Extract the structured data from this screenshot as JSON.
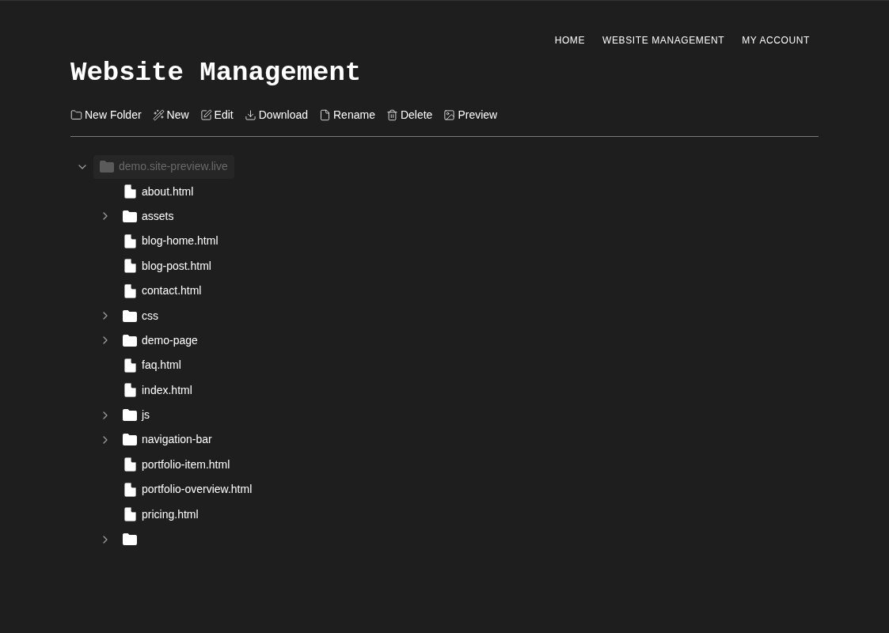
{
  "nav": [
    {
      "label": "HOME"
    },
    {
      "label": "WEBSITE MANAGEMENT"
    },
    {
      "label": "MY ACCOUNT"
    }
  ],
  "page_title": "Website Management",
  "toolbar": [
    {
      "kind": "folder",
      "label": "New Folder"
    },
    {
      "kind": "wand",
      "label": "New"
    },
    {
      "kind": "edit",
      "label": "Edit"
    },
    {
      "kind": "download",
      "label": "Download"
    },
    {
      "kind": "file",
      "label": "Rename"
    },
    {
      "kind": "trash",
      "label": "Delete"
    },
    {
      "kind": "image",
      "label": "Preview"
    }
  ],
  "tree": {
    "kind": "folder",
    "name": "demo.site-preview.live",
    "expanded": true,
    "selected": true,
    "children": [
      {
        "kind": "file",
        "name": "about.html"
      },
      {
        "kind": "folder",
        "name": "assets",
        "expanded": false
      },
      {
        "kind": "file",
        "name": "blog-home.html"
      },
      {
        "kind": "file",
        "name": "blog-post.html"
      },
      {
        "kind": "file",
        "name": "contact.html"
      },
      {
        "kind": "folder",
        "name": "css",
        "expanded": false
      },
      {
        "kind": "folder",
        "name": "demo-page",
        "expanded": false
      },
      {
        "kind": "file",
        "name": "faq.html"
      },
      {
        "kind": "file",
        "name": "index.html"
      },
      {
        "kind": "folder",
        "name": "js",
        "expanded": false
      },
      {
        "kind": "folder",
        "name": "navigation-bar",
        "expanded": false
      },
      {
        "kind": "file",
        "name": "portfolio-item.html"
      },
      {
        "kind": "file",
        "name": "portfolio-overview.html"
      },
      {
        "kind": "file",
        "name": "pricing.html"
      },
      {
        "kind": "folder",
        "expanded": false
      }
    ]
  }
}
